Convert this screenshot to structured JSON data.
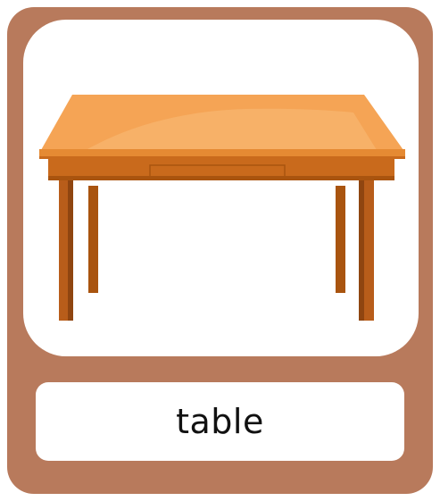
{
  "card": {
    "word": "table",
    "image_subject": "table-illustration",
    "colors": {
      "frame": "#b87a5c",
      "panel": "#ffffff",
      "tabletop": "#f5a455",
      "tabletop_highlight": "#f8b670",
      "apron": "#c96a1c",
      "apron_dark": "#a9540f",
      "legs": "#b85d1a",
      "legs_dark": "#8f4510"
    }
  }
}
